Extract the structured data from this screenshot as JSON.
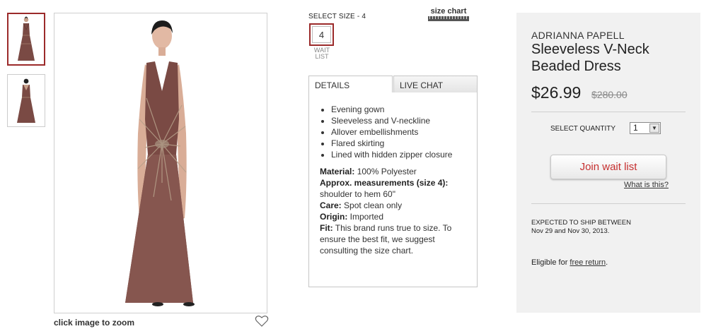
{
  "gallery": {
    "thumbnails": [
      "front-view",
      "back-view"
    ],
    "zoom_caption": "click image to zoom",
    "favorite_icon": "heart-outline-icon"
  },
  "size": {
    "title": "SELECT SIZE - 4",
    "size_chart_label": "size chart",
    "selected_size": "4",
    "wait_list_label": "WAIT LIST"
  },
  "tabs": {
    "details_label": "DETAILS",
    "live_chat_label": "LIVE CHAT"
  },
  "details": {
    "bullets": [
      "Evening gown",
      "Sleeveless and V-neckline",
      "Allover embellishments",
      "Flared skirting",
      "Lined with hidden zipper closure"
    ],
    "material_label": "Material:",
    "material_value": " 100% Polyester",
    "measure_label": "Approx. measurements (size 4):",
    "measure_value": " shoulder to hem 60\"",
    "care_label": "Care:",
    "care_value": " Spot clean only",
    "origin_label": "Origin:",
    "origin_value": " Imported",
    "fit_label": "Fit:",
    "fit_value": " This brand runs true to size. To ensure the best fit, we suggest consulting the size chart."
  },
  "product": {
    "brand": "ADRIANNA PAPELL",
    "name": "Sleeveless V-Neck Beaded Dress",
    "price": "$26.99",
    "original_price": "$280.00",
    "quantity_label": "SELECT QUANTITY",
    "quantity_value": "1",
    "join_button": "Join wait list",
    "what_link": "What is this?",
    "ship_heading": "EXPECTED TO SHIP BETWEEN",
    "ship_dates": "Nov 29 and Nov 30, 2013.",
    "eligible_prefix": "Eligible for ",
    "free_return": "free return",
    "eligible_suffix": "."
  },
  "colors": {
    "accent": "#9b2a2a",
    "join_text": "#c62f2f",
    "dress": "#7a4a44",
    "buybox_bg": "#f1f1f1"
  }
}
